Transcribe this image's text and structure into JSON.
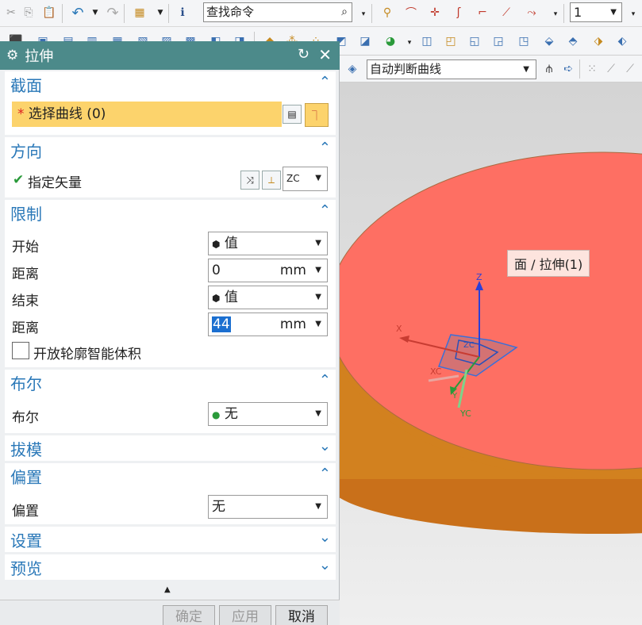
{
  "toolbar": {
    "search_value": "查找命令",
    "layer_value": "1",
    "curve_rule": "自动判断曲线"
  },
  "dialog": {
    "title": "拉伸",
    "section": {
      "header": "截面",
      "select_curve_label": "选择曲线 (0)",
      "required_mark": "*"
    },
    "direction": {
      "header": "方向",
      "specify_vector_label": "指定矢量",
      "vector_value": "ZC"
    },
    "limits": {
      "header": "限制",
      "start_label": "开始",
      "start_value": "值",
      "distance1_label": "距离",
      "distance1_value": "0",
      "distance1_unit": "mm",
      "end_label": "结束",
      "end_value": "值",
      "distance2_label": "距离",
      "distance2_value": "44",
      "distance2_unit": "mm",
      "open_profile_label": "开放轮廓智能体积"
    },
    "boolean": {
      "header": "布尔",
      "label": "布尔",
      "value": "无"
    },
    "draft": {
      "header": "拔模"
    },
    "offset": {
      "header": "偏置",
      "label": "偏置",
      "value": "无"
    },
    "settings": {
      "header": "设置"
    },
    "preview": {
      "header": "预览"
    },
    "buttons": {
      "ok": "确定",
      "apply": "应用",
      "cancel": "取消"
    }
  },
  "viewport": {
    "tooltip": "面 / 拉伸(1)",
    "axis_labels": {
      "z": "Z",
      "x": "X",
      "y": "Y",
      "xc": "XC",
      "yc": "YC",
      "zc": "ZC"
    }
  },
  "colors": {
    "title_bar": "#4c8a8a",
    "group_header": "#2a78b8",
    "selection_row": "#fcd36c",
    "face_fill": "#fe6f63",
    "side_fill": "#d2811f"
  }
}
